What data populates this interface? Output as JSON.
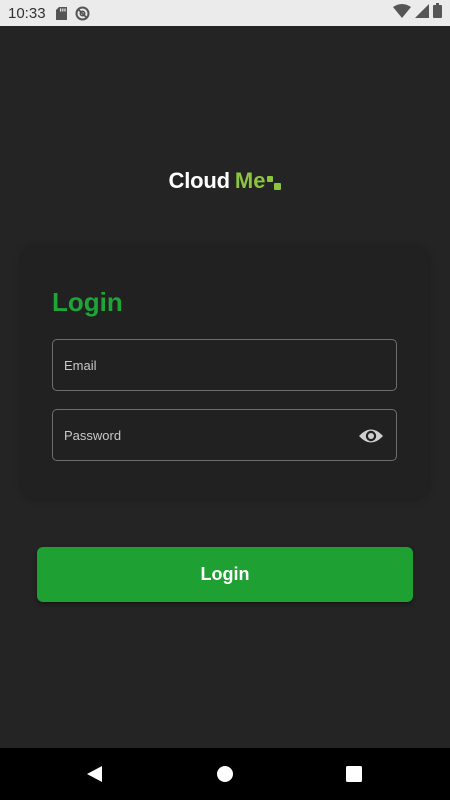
{
  "status_bar": {
    "time": "10:33",
    "icons": [
      "sd-card-icon",
      "sync-icon",
      "wifi-icon",
      "signal-icon",
      "battery-icon"
    ]
  },
  "logo": {
    "part1": "Cloud",
    "part2": "Me",
    "accent_color": "#8bc43f"
  },
  "login_card": {
    "title": "Login",
    "email_placeholder": "Email",
    "password_placeholder": "Password",
    "password_toggle_icon": "eye-icon"
  },
  "login_button": {
    "label": "Login",
    "color": "#1ea033"
  },
  "nav_bar": {
    "icons": [
      "back-icon",
      "home-icon",
      "recents-icon"
    ]
  }
}
